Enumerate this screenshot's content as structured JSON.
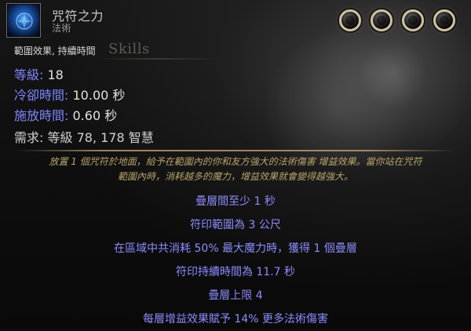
{
  "skill": {
    "name": "咒符之力",
    "type": "法術",
    "tags": "範圍效果, 持續時間",
    "background_label": "Skills"
  },
  "stats": {
    "level_label": "等級:",
    "level_value": "18",
    "cooldown_label": "冷卻時間:",
    "cooldown_value": "10.00 秒",
    "cast_time_label": "施放時間:",
    "cast_time_value": "0.60 秒",
    "requirements_label": "需求:",
    "requirements_value": "等級 78, 178 智慧"
  },
  "description": {
    "line1": "放置 1 個咒符於地面，給予在範圍內的你和友方強大的法術傷害 增益效果。當你站在咒符",
    "line2": "範圍內時，消耗越多的魔力，增益效果就會變得越強大。"
  },
  "modifiers": [
    "疊層間至少 1 秒",
    "符印範圍為 3 公尺",
    "在區域中共消耗 50% 最大魔力時，獲得 1 個疊層",
    "符印持續時間為 11.7 秒",
    "疊層上限 4",
    "每層增益效果賦予 14% 更多法術傷害"
  ],
  "colors": {
    "stat_label": "#7f86ff",
    "description": "#b7a36a",
    "modifier": "#8c8cff",
    "divider": "#beaa6e",
    "icon_accent": "#4fb4ff",
    "orb_ring": "#cfc2a2"
  },
  "icons": {
    "skill_icon": "sigil-of-power-icon",
    "orb_icon": "socket-orb-icon"
  }
}
